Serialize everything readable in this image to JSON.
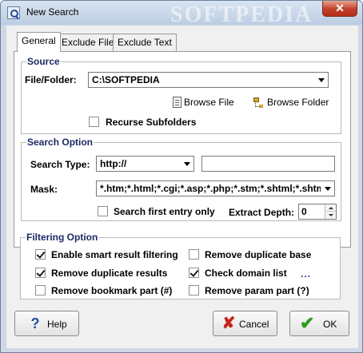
{
  "window": {
    "title": "New Search",
    "watermark": "SOFTPEDIA",
    "close_label": "✕"
  },
  "tabs": [
    {
      "label": "General",
      "active": true
    },
    {
      "label": "Exclude File",
      "active": false
    },
    {
      "label": "Exclude Text",
      "active": false
    }
  ],
  "source": {
    "title": "Source",
    "file_folder_label": "File/Folder:",
    "file_folder_value": "C:\\SOFTPEDIA",
    "browse_file_label": "Browse File",
    "browse_folder_label": "Browse Folder",
    "recurse_label": "Recurse Subfolders",
    "recurse_checked": false
  },
  "search_option": {
    "title": "Search Option",
    "search_type_label": "Search Type:",
    "search_type_value": "http://",
    "search_text_value": "",
    "mask_label": "Mask:",
    "mask_value": "*.htm;*.html;*.cgi;*.asp;*.php;*.stm;*.shtml;*.shtm;",
    "first_entry_label": "Search first entry only",
    "first_entry_checked": false,
    "extract_depth_label": "Extract Depth:",
    "extract_depth_value": "0"
  },
  "filtering": {
    "title": "Filtering Option",
    "smart_label": "Enable smart result filtering",
    "smart_checked": true,
    "dup_results_label": "Remove duplicate results",
    "dup_results_checked": true,
    "bookmark_label": "Remove bookmark part (#)",
    "bookmark_checked": false,
    "dup_base_label": "Remove duplicate base",
    "dup_base_checked": false,
    "domain_list_label": "Check domain list",
    "domain_list_checked": true,
    "domain_list_more": "...",
    "param_label": "Remove param part (?)",
    "param_checked": false
  },
  "buttons": {
    "help_label": "Help",
    "cancel_label": "Cancel",
    "ok_label": "OK"
  },
  "colors": {
    "group_title": "#1c2a63",
    "ok_check": "#2f9b22",
    "cancel_x": "#c4261c",
    "help_mark": "#1e4f9b"
  }
}
